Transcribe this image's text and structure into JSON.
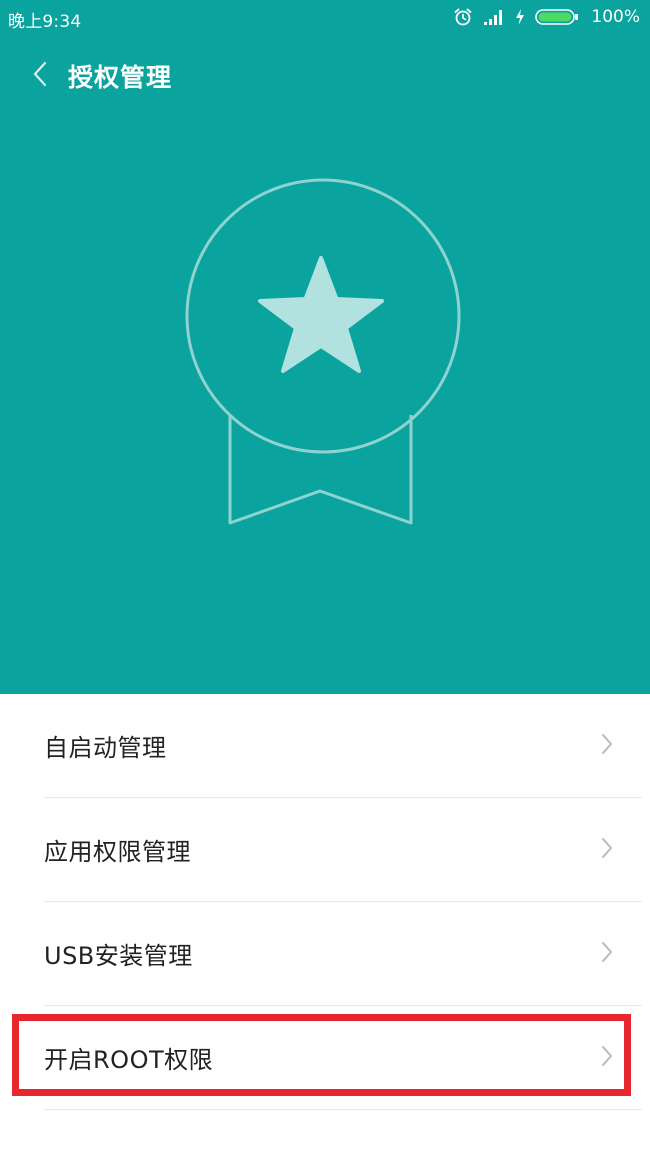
{
  "status_bar": {
    "time": "晚上9:34",
    "battery_percent": "100%",
    "icons": [
      "alarm-icon",
      "signal-icon",
      "charging-icon",
      "battery-icon"
    ]
  },
  "title_bar": {
    "back_icon": "back-chevron-icon",
    "title": "授权管理"
  },
  "hero": {
    "icon": "award-medal-star-icon",
    "background_color": "#0aa39e"
  },
  "list": {
    "items": [
      {
        "label": "自启动管理",
        "icon": "chevron-right-icon"
      },
      {
        "label": "应用权限管理",
        "icon": "chevron-right-icon"
      },
      {
        "label": "USB安装管理",
        "icon": "chevron-right-icon"
      },
      {
        "label": "开启ROOT权限",
        "icon": "chevron-right-icon",
        "highlighted": true
      }
    ]
  },
  "colors": {
    "accent": "#0aa39e",
    "highlight": "#e8262e",
    "star": "#b2e2e0"
  }
}
